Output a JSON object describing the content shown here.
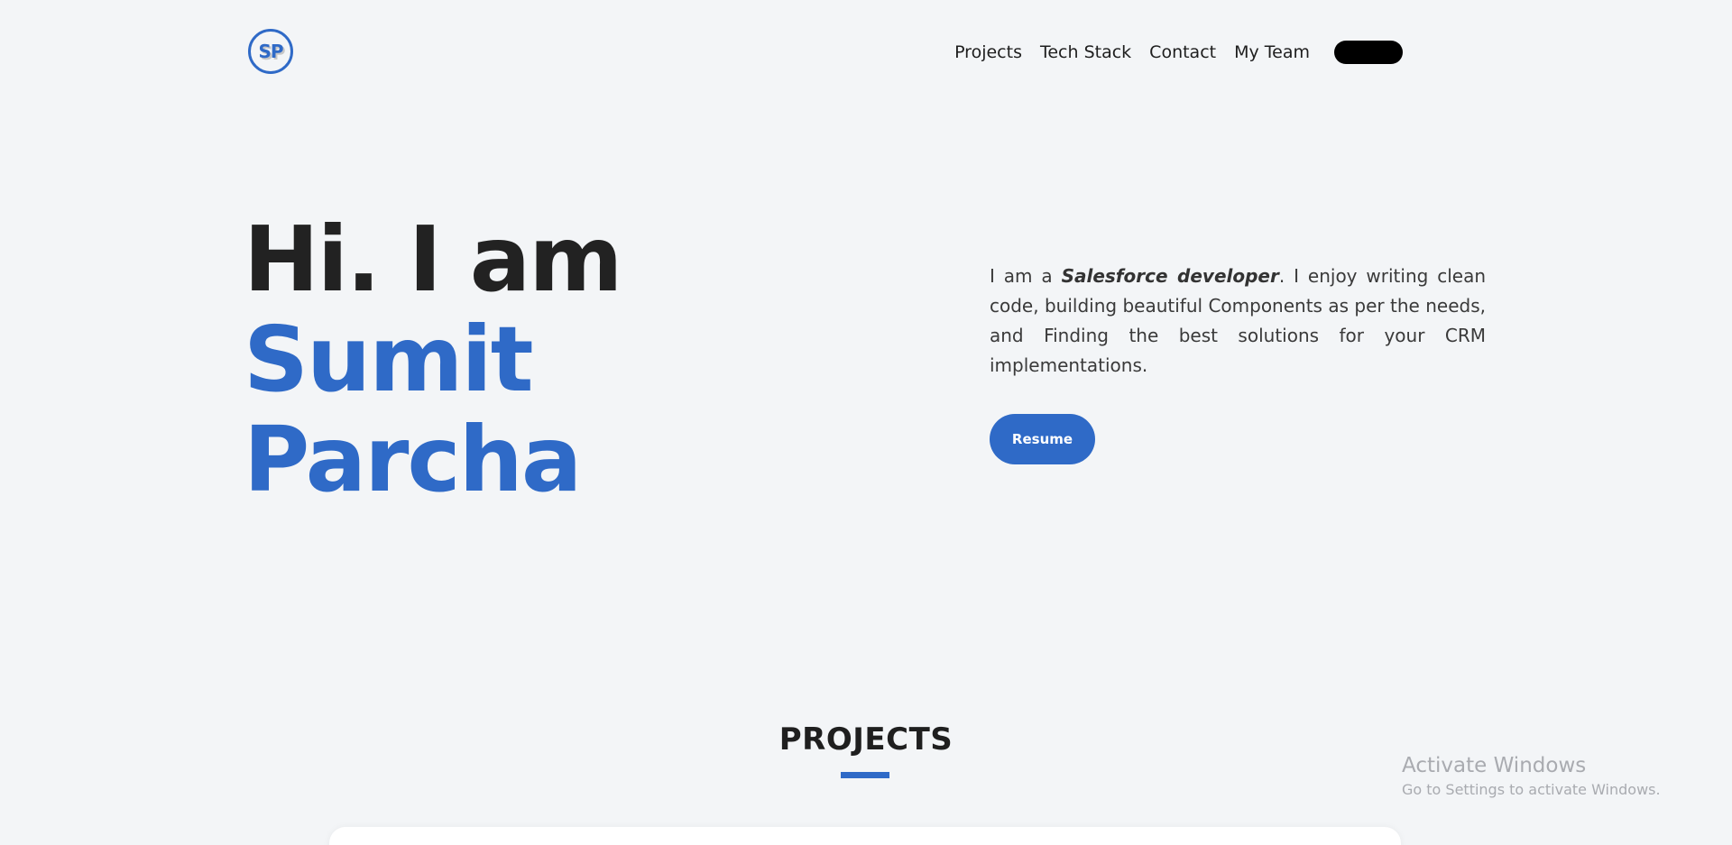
{
  "header": {
    "logo_text": "SP",
    "nav": [
      "Projects",
      "Tech Stack",
      "Contact",
      "My Team"
    ]
  },
  "hero": {
    "greeting": "Hi. I am",
    "first_name": "Sumit",
    "last_name": "Parcha",
    "about_prefix": "I am a ",
    "about_role": "Salesforce developer",
    "about_suffix": ". I enjoy writing clean code, building beautiful Components as per the needs, and Finding the best solutions for your CRM implementations.",
    "resume_label": "Resume"
  },
  "projects": {
    "heading": "PROJECTS"
  },
  "watermark": {
    "title": "Activate Windows",
    "subtitle": "Go to Settings to activate Windows."
  },
  "colors": {
    "accent": "#2f6ac7",
    "background": "#f3f5f7",
    "text": "#222222"
  }
}
